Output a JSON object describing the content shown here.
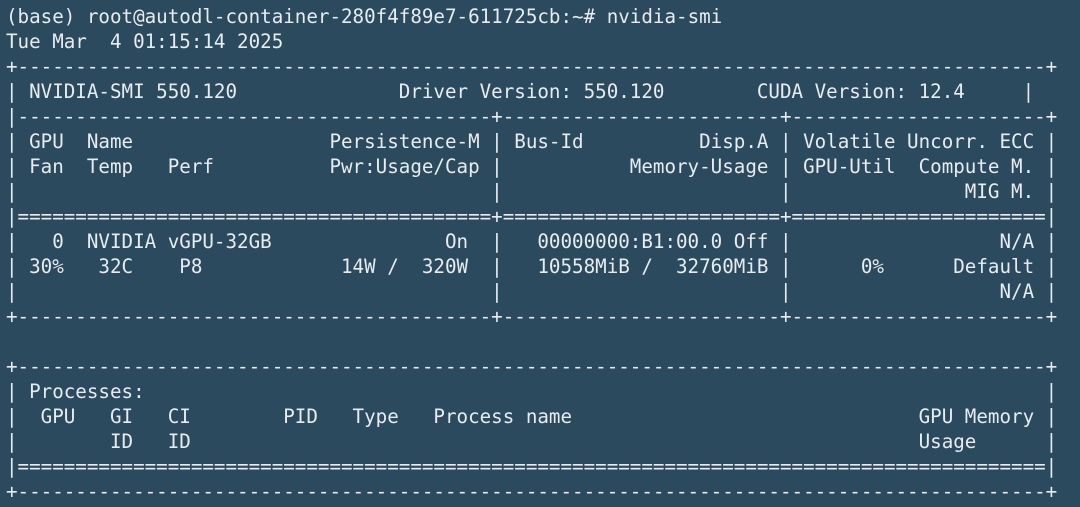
{
  "window": {
    "background": "#2c4a5d",
    "foreground": "#e6ecef"
  },
  "terminal": {
    "prompt": "(base) root@autodl-container-280f4f89e7-611725cb:~# ",
    "command": "nvidia-smi",
    "lines": [
      "Tue Mar  4 01:15:14 2025",
      "+-----------------------------------------------------------------------------------------+",
      "| NVIDIA-SMI 550.120              Driver Version: 550.120        CUDA Version: 12.4     |",
      "|-----------------------------------------+------------------------+----------------------+",
      "| GPU  Name                 Persistence-M | Bus-Id          Disp.A | Volatile Uncorr. ECC |",
      "| Fan  Temp   Perf          Pwr:Usage/Cap |           Memory-Usage | GPU-Util  Compute M. |",
      "|                                         |                        |               MIG M. |",
      "|=========================================+========================+======================|",
      "|   0  NVIDIA vGPU-32GB               On  |   00000000:B1:00.0 Off |                  N/A |",
      "| 30%   32C    P8            14W /  320W  |   10558MiB /  32760MiB |      0%      Default |",
      "|                                         |                        |                  N/A |",
      "+-----------------------------------------+------------------------+----------------------+",
      "",
      "+-----------------------------------------------------------------------------------------+",
      "| Processes:                                                                              |",
      "|  GPU   GI   CI        PID   Type   Process name                              GPU Memory |",
      "|        ID   ID                                                               Usage      |",
      "|=========================================================================================|",
      "+-----------------------------------------------------------------------------------------+"
    ]
  }
}
